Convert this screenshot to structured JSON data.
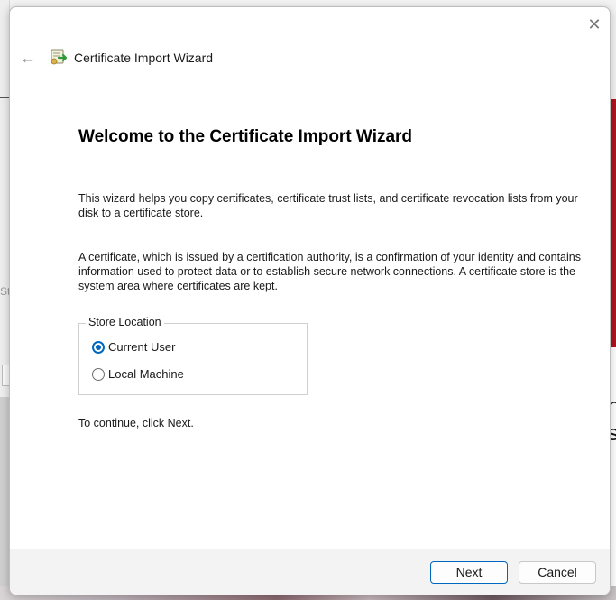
{
  "window": {
    "title": "Certificate Import Wizard",
    "close_glyph": "✕",
    "back_glyph": "←"
  },
  "content": {
    "heading": "Welcome to the Certificate Import Wizard",
    "paragraph1": "This wizard helps you copy certificates, certificate trust lists, and certificate revocation lists from your disk to a certificate store.",
    "paragraph2": "A certificate, which is issued by a certification authority, is a confirmation of your identity and contains information used to protect data or to establish secure network connections. A certificate store is the system area where certificates are kept.",
    "store_location": {
      "legend": "Store Location",
      "options": [
        {
          "label": "Current User",
          "selected": true
        },
        {
          "label": "Local Machine",
          "selected": false
        }
      ]
    },
    "continue_text": "To continue, click Next."
  },
  "footer": {
    "next_label": "Next",
    "cancel_label": "Cancel"
  },
  "background": {
    "left_text": "St",
    "right_text": "h\ns"
  },
  "colors": {
    "accent": "#0067c0",
    "footer_bg": "#f3f3f3"
  },
  "icons": {
    "title_icon": "certificate-icon",
    "back": "back-arrow-icon",
    "close": "close-icon"
  }
}
